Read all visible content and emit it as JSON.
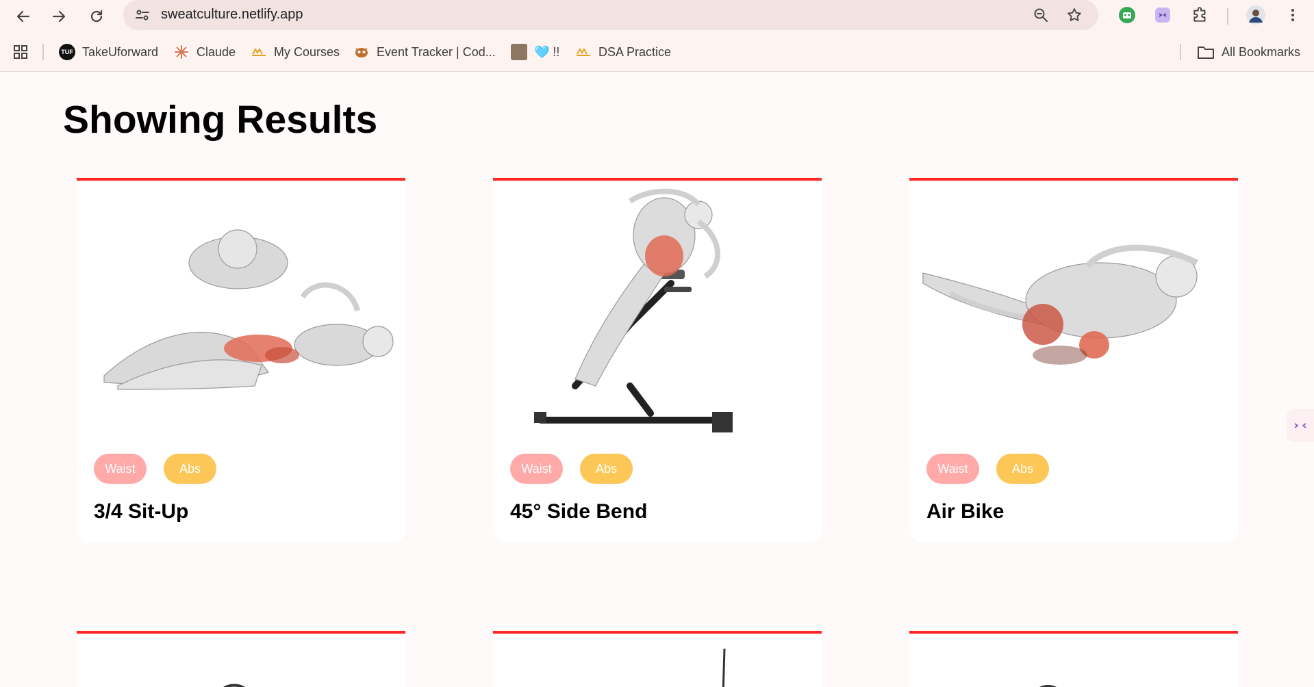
{
  "browser": {
    "url": "sweatculture.netlify.app",
    "bookmarks": [
      {
        "label": "TakeUforward",
        "icon": "takeuforward-favicon",
        "favicon_text": "TUF"
      },
      {
        "label": "Claude",
        "icon": "claude-favicon"
      },
      {
        "label": "My Courses",
        "icon": "courses-favicon"
      },
      {
        "label": "Event Tracker | Cod...",
        "icon": "event-tracker-favicon"
      },
      {
        "label": "🩵 !!",
        "icon": "photo-favicon"
      },
      {
        "label": "DSA Practice",
        "icon": "dsa-favicon"
      }
    ],
    "all_bookmarks_label": "All Bookmarks"
  },
  "page": {
    "title": "Showing Results"
  },
  "exercises": [
    {
      "name": "3/4 Sit-Up",
      "body_part": "Waist",
      "target": "Abs"
    },
    {
      "name": "45° Side Bend",
      "body_part": "Waist",
      "target": "Abs"
    },
    {
      "name": "Air Bike",
      "body_part": "Waist",
      "target": "Abs"
    }
  ],
  "colors": {
    "accent_red": "#ff2625",
    "body_part_pill": "#ffa9a9",
    "target_pill": "#fcc757",
    "page_bg": "#fffafa"
  }
}
